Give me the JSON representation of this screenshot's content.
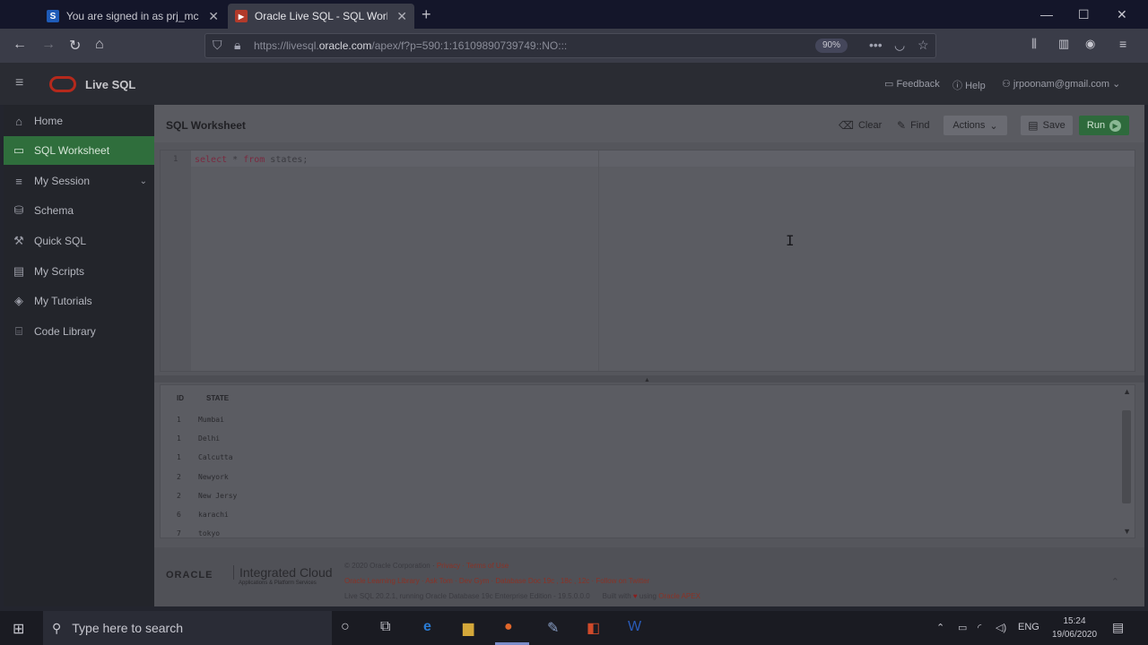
{
  "browser": {
    "tabs": [
      {
        "label": "You are signed in as prj_mc",
        "favicon": "S",
        "favicon_color": "#1e5bb8"
      },
      {
        "label": "Oracle Live SQL - SQL Workshe",
        "favicon": "▶",
        "favicon_color": "#b23a2a"
      }
    ],
    "url_prefix": "https://livesql.",
    "url_domain": "oracle.com",
    "url_suffix": "/apex/f?p=590:1:16109890739749::NO:::",
    "zoom": "90%"
  },
  "header": {
    "brand": "Live SQL",
    "feedback": "Feedback",
    "help": "Help",
    "user": "jrpoonam@gmail.com"
  },
  "sidebar": {
    "items": [
      {
        "label": "Home",
        "icon": "home-icon",
        "glyph": "⌂"
      },
      {
        "label": "SQL Worksheet",
        "icon": "worksheet-icon",
        "glyph": "▭"
      },
      {
        "label": "My Session",
        "icon": "list-icon",
        "glyph": "≡"
      },
      {
        "label": "Schema",
        "icon": "database-icon",
        "glyph": "⛁"
      },
      {
        "label": "Quick SQL",
        "icon": "wand-icon",
        "glyph": "⚒"
      },
      {
        "label": "My Scripts",
        "icon": "file-icon",
        "glyph": "▤"
      },
      {
        "label": "My Tutorials",
        "icon": "tutorial-icon",
        "glyph": "◈"
      },
      {
        "label": "Code Library",
        "icon": "library-icon",
        "glyph": "⌸"
      }
    ]
  },
  "worksheet": {
    "title": "SQL Worksheet",
    "clear": "Clear",
    "find": "Find",
    "actions": "Actions",
    "save": "Save",
    "run": "Run",
    "line_no": "1",
    "code_kw1": "select",
    "code_mid": " * ",
    "code_kw2": "from",
    "code_rest": " states;"
  },
  "results": {
    "columns": [
      "ID",
      "STATE"
    ],
    "rows": [
      [
        "1",
        "Mumbai"
      ],
      [
        "1",
        "Delhi"
      ],
      [
        "1",
        "Calcutta"
      ],
      [
        "2",
        "Newyork"
      ],
      [
        "2",
        "New Jersy"
      ],
      [
        "6",
        "karachi"
      ],
      [
        "7",
        "tokyo"
      ]
    ]
  },
  "footer": {
    "oracle": "ORACLE",
    "integrated": "Integrated Cloud",
    "integrated_sub": "Applications & Platform Services",
    "copyright": "© 2020 Oracle Corporation · ",
    "privacy_terms": "Privacy · Terms of Use",
    "links": "Oracle Learning Library · Ask Tom · Dev Gym · Database Doc 19c , 18c , 12c · Follow on Twitter",
    "version": "Live SQL 20.2.1, running Oracle Database 19c Enterprise Edition - 19.5.0.0.0",
    "built_with": "Built with",
    "using": " using ",
    "apex": "Oracle APEX"
  },
  "taskbar": {
    "search_placeholder": "Type here to search",
    "lang": "ENG",
    "time": "15:24",
    "date": "19/06/2020"
  },
  "colors": {
    "active_nav": "#2f6e3c",
    "brand_red": "#b5291c",
    "run_green": "#2e6a3c"
  }
}
